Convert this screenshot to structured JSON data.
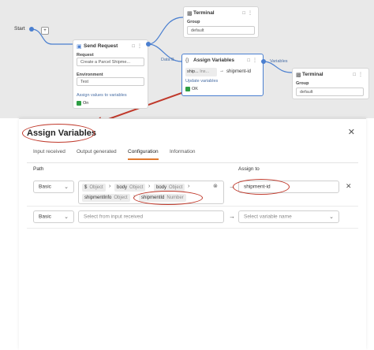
{
  "canvas": {
    "start_label": "Start",
    "send_request": {
      "title": "Send Request",
      "request_label": "Request",
      "request_value": "Create a Parcel Shipme...",
      "environment_label": "Environment",
      "environment_value": "Test",
      "link_text": "Assign values to variables",
      "on_label": "On"
    },
    "terminal_top": {
      "title": "Terminal",
      "group_label": "Group",
      "group_value": "default"
    },
    "assign_node": {
      "title": "Assign Variables",
      "chip_text": "ship...",
      "chip_type": "Ins...",
      "target": "shipment-id",
      "link_text": "Update variables",
      "ok_label": "OK"
    },
    "terminal_right": {
      "title": "Terminal",
      "group_label": "Group",
      "group_value": "default"
    },
    "edges": {
      "data_b": "Data B",
      "variables": "Variables"
    }
  },
  "modal": {
    "title": "Assign Variables",
    "tabs": [
      "Input received",
      "Output generated",
      "Configuration",
      "Information"
    ],
    "path_header": "Path",
    "assign_header": "Assign to",
    "row1": {
      "mode": "Basic",
      "path": [
        {
          "name": "$",
          "type": "Object"
        },
        {
          "name": "body",
          "type": "Object"
        },
        {
          "name": "body",
          "type": "Object"
        },
        {
          "name": "shipmentInfo",
          "type": "Object"
        },
        {
          "name": "shipmentId",
          "type": "Number"
        }
      ],
      "assign_value": "shipment-id"
    },
    "row2": {
      "mode": "Basic",
      "path_placeholder": "Select from input received",
      "assign_placeholder": "Select variable name"
    }
  },
  "colors": {
    "accent_tab": "#e07a2f",
    "annotation_red": "#c0392b",
    "connector_blue": "#4a7fd0",
    "on_green": "#2e9e44"
  }
}
